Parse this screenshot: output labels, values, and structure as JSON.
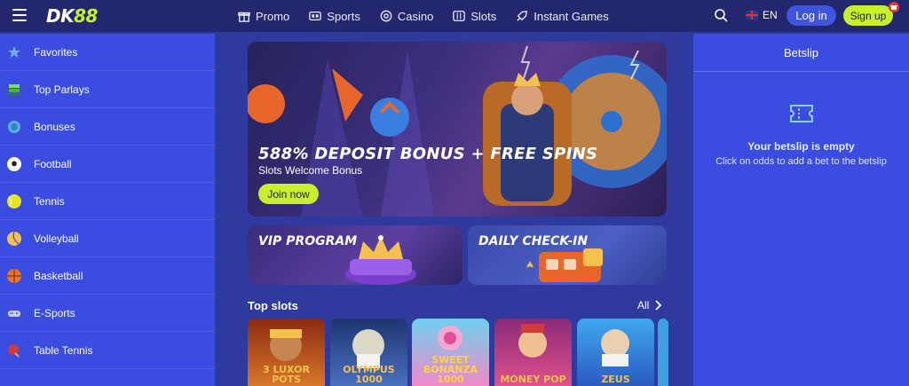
{
  "header": {
    "logo_main": "DK",
    "logo_accent": "88",
    "nav": [
      {
        "label": "Promo",
        "icon": "gift-icon"
      },
      {
        "label": "Sports",
        "icon": "scoreboard-icon"
      },
      {
        "label": "Casino",
        "icon": "casino-chip-icon"
      },
      {
        "label": "Slots",
        "icon": "slot-machine-icon"
      },
      {
        "label": "Instant Games",
        "icon": "rocket-icon"
      }
    ],
    "language": "EN",
    "login_label": "Log in",
    "signup_label": "Sign up"
  },
  "sidebar": {
    "items": [
      {
        "label": "Favorites",
        "icon": "star-icon",
        "color": "#6fb1ff"
      },
      {
        "label": "Top Parlays",
        "icon": "stack-icon",
        "color": "#4caf50"
      },
      {
        "label": "Bonuses",
        "icon": "coin-icon",
        "color": "#5dade2"
      },
      {
        "label": "Football",
        "icon": "soccer-ball-icon",
        "color": "#ffffff"
      },
      {
        "label": "Tennis",
        "icon": "tennis-ball-icon",
        "color": "#e6e619"
      },
      {
        "label": "Volleyball",
        "icon": "volleyball-icon",
        "color": "#f2c14e"
      },
      {
        "label": "Basketball",
        "icon": "basketball-icon",
        "color": "#e8732c"
      },
      {
        "label": "E-Sports",
        "icon": "gamepad-icon",
        "color": "#c9ccd8"
      },
      {
        "label": "Table Tennis",
        "icon": "ping-pong-icon",
        "color": "#d23a3a"
      }
    ]
  },
  "hero": {
    "title": "588% DEPOSIT BONUS + FREE SPINS",
    "subtitle": "Slots Welcome Bonus",
    "cta": "Join now"
  },
  "promos": [
    {
      "title": "VIP PROGRAM"
    },
    {
      "title": "DAILY CHECK-IN"
    }
  ],
  "top_slots": {
    "title": "Top slots",
    "all_label": "All",
    "games": [
      {
        "label": "3 LUXOR POTS",
        "color": "#c9521e"
      },
      {
        "label": "OLYMPUS 1000",
        "color": "#3a5aa8"
      },
      {
        "label": "SWEET BONANZA 1000",
        "color": "#e86fb2"
      },
      {
        "label": "MONEY POP",
        "color": "#c83a7a"
      },
      {
        "label": "ZEUS",
        "color": "#2f8fd8"
      }
    ]
  },
  "betslip": {
    "title": "Betslip",
    "empty_title": "Your betslip is empty",
    "empty_hint": "Click on odds to add a bet to the betslip"
  },
  "colors": {
    "accent": "#c8f02a",
    "topbar": "#23286e",
    "panel": "#3a4de0",
    "main_bg": "#2e3a9e"
  }
}
